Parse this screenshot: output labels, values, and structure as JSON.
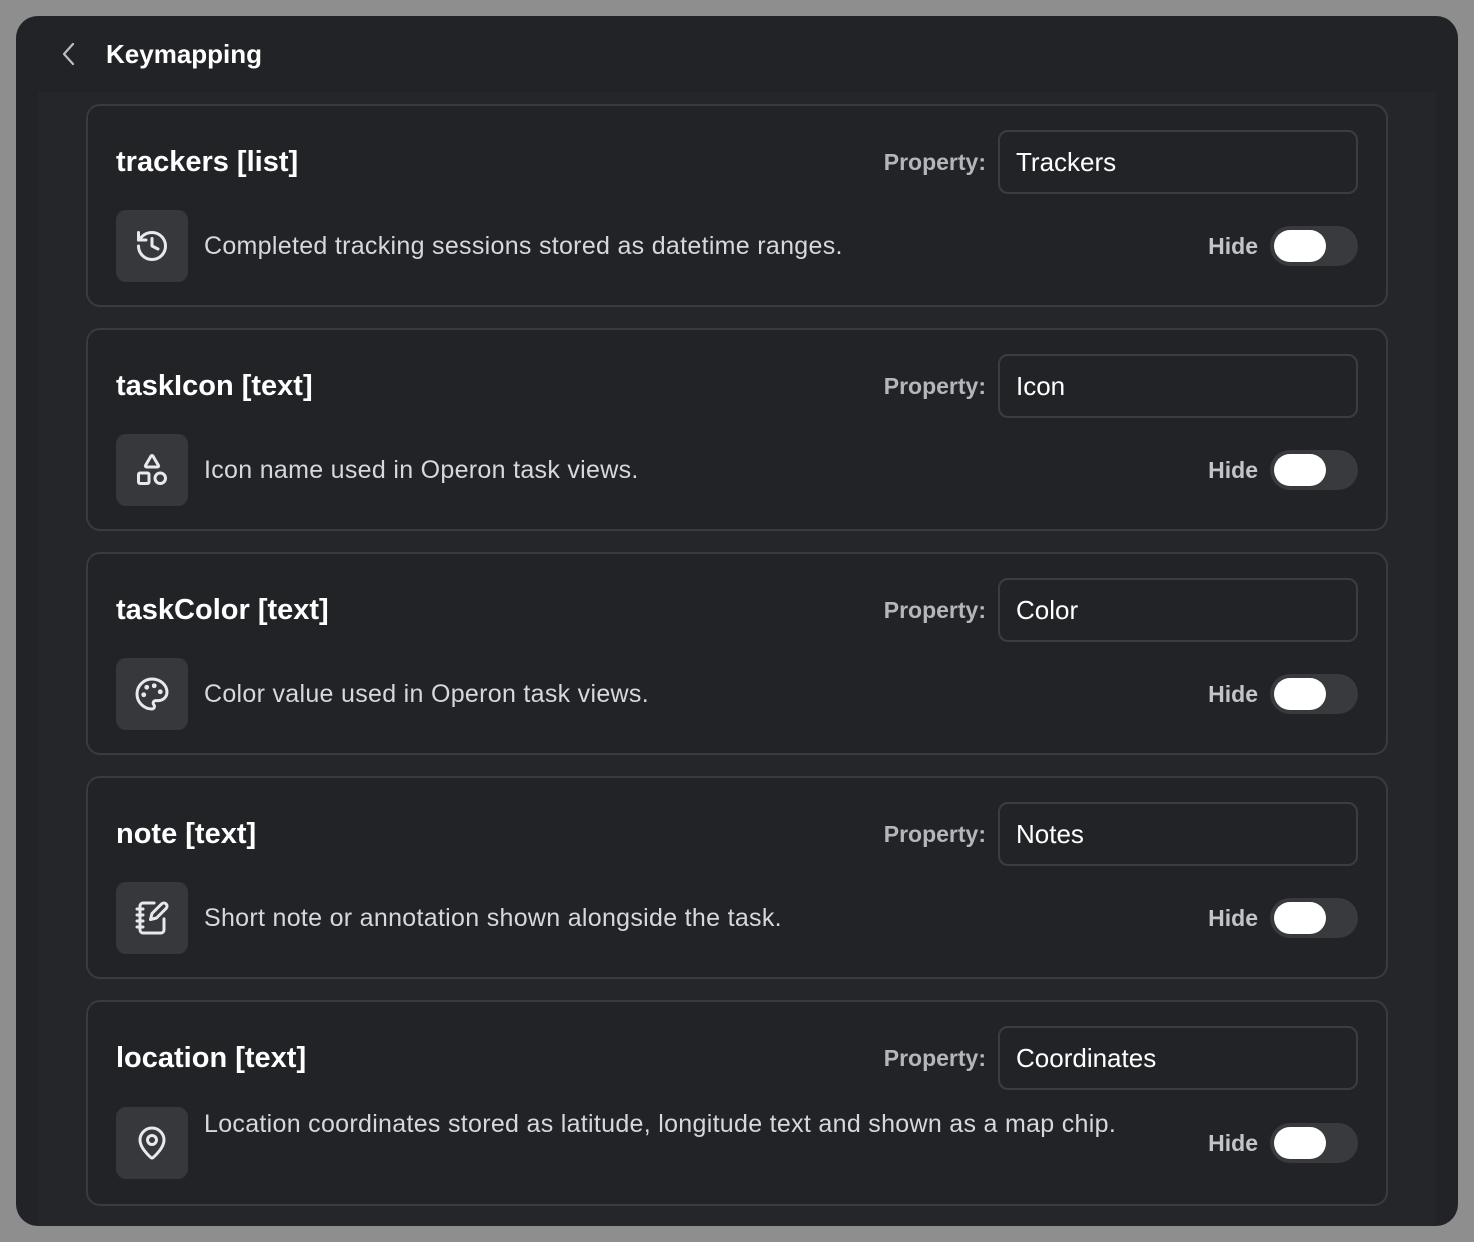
{
  "header": {
    "title": "Keymapping",
    "back_icon": "chevron-left-icon"
  },
  "fields": [
    {
      "title": "trackers [list]",
      "property_label": "Property:",
      "property_value": "Trackers",
      "icon": "history-icon",
      "description": "Completed tracking sessions stored as datetime ranges.",
      "hide_label": "Hide",
      "hidden": false
    },
    {
      "title": "taskIcon [text]",
      "property_label": "Property:",
      "property_value": "Icon",
      "icon": "shapes-icon",
      "description": "Icon name used in Operon task views.",
      "hide_label": "Hide",
      "hidden": false
    },
    {
      "title": "taskColor [text]",
      "property_label": "Property:",
      "property_value": "Color",
      "icon": "palette-icon",
      "description": "Color value used in Operon task views.",
      "hide_label": "Hide",
      "hidden": false
    },
    {
      "title": "note [text]",
      "property_label": "Property:",
      "property_value": "Notes",
      "icon": "notebook-pen-icon",
      "description": "Short note or annotation shown alongside the task.",
      "hide_label": "Hide",
      "hidden": false
    },
    {
      "title": "location [text]",
      "property_label": "Property:",
      "property_value": "Coordinates",
      "icon": "map-pin-icon",
      "description": "Location coordinates stored as latitude, longitude text and shown as a map chip.",
      "hide_label": "Hide",
      "hidden": false
    }
  ],
  "colors": {
    "window_bg": "#222326",
    "card_border": "#3a3b3f",
    "icon_box_bg": "#37383c",
    "toggle_track": "#393a3e",
    "toggle_knob": "#ffffff",
    "text_primary": "#ffffff",
    "text_secondary": "#d7d8dc"
  }
}
